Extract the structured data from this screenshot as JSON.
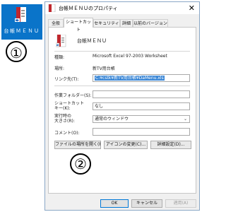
{
  "desktop": {
    "shortcut_label": "台帳ＭＥＮＵ",
    "callout_1": "①"
  },
  "window": {
    "title": "台帳ＭＥＮＵのプロパティ",
    "close_symbol": "✕",
    "tabs": [
      {
        "label": "全般",
        "active": false
      },
      {
        "label": "ショートカット",
        "active": true
      },
      {
        "label": "セキュリティ",
        "active": false
      },
      {
        "label": "詳細",
        "active": false
      },
      {
        "label": "以前のバージョン",
        "active": false
      }
    ]
  },
  "shortcut": {
    "name": "台帳ＭＥＮＵ",
    "type_label": "種類:",
    "type_value": "Microsoft Excel 97-2003 Worksheet",
    "location_label": "場所:",
    "location_value": "新TV用台帳",
    "target_label": "リンク先(T):",
    "target_value": "C:¥cstk¥新TV用台帳¥DaMenu.xls",
    "start_in_label": "作業フォルダー(S):",
    "start_in_value": "",
    "shortcut_key_label": "ショートカット\nキー(K):",
    "shortcut_key_value": "なし",
    "run_label": "実行時の\n大きさ(R):",
    "run_value": "通常のウィンドウ",
    "comment_label": "コメント(O):",
    "comment_value": "",
    "open_location_button": "ファイルの場所を開く(F)",
    "change_icon_button": "アイコンの変更(C)...",
    "advanced_button": "詳細設定(D)...",
    "callout_2": "②"
  },
  "footer": {
    "ok": "OK",
    "cancel": "キャンセル",
    "apply": "適用(A)"
  },
  "colors": {
    "desktop_icon_bg": "#0a74c9",
    "selection": "#3b87d6",
    "excel_red": "#c0272d"
  }
}
